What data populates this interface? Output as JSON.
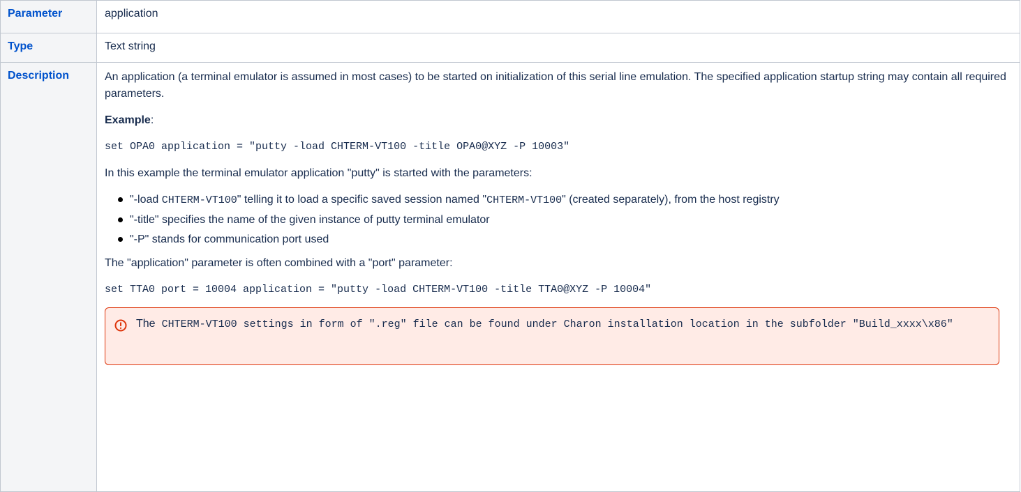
{
  "rows": {
    "parameter": {
      "label": "Parameter",
      "value": "application"
    },
    "type": {
      "label": "Type",
      "value": "Text string"
    },
    "description": {
      "label": "Description",
      "intro": "An application (a terminal emulator is assumed in most cases) to be started on initialization of this serial line emulation. The specified application startup string may contain all required parameters.",
      "example_label": "Example",
      "example_colon": ":",
      "example_code": "set OPA0 application = \"putty -load CHTERM-VT100 -title OPA0@XYZ -P 10003\"",
      "explanation": "In this example the terminal emulator application \"putty\" is started with the parameters:",
      "bullets": [
        {
          "pre": "\"-load ",
          "code": "CHTERM-VT100",
          "mid": "\" telling it to load a specific saved session named \"",
          "code2": "CHTERM-VT100",
          "post": "\" (created separately), from the host registry"
        },
        {
          "text": "\"-title\" specifies the name of the given instance of putty terminal emulator"
        },
        {
          "text": "\"-P\" stands for communication port used"
        }
      ],
      "combined": "The \"application\" parameter is often combined with a \"port\" parameter:",
      "combined_code": "set TTA0 port = 10004 application = \"putty -load CHTERM-VT100 -title TTA0@XYZ -P 10004\"",
      "note": {
        "lead": "The",
        "code": " CHTERM-VT100 settings in form of \".reg\" file can be found under Charon installation location in the subfolder \"Build_xxxx\\x86\"",
        "icon": "error-icon",
        "border_color": "#de350b",
        "background_color": "#ffebe6"
      }
    }
  },
  "colors": {
    "key_text": "#0052cc",
    "key_background": "#f4f5f7",
    "border": "#c1c7d0",
    "body_text": "#172b4d"
  }
}
